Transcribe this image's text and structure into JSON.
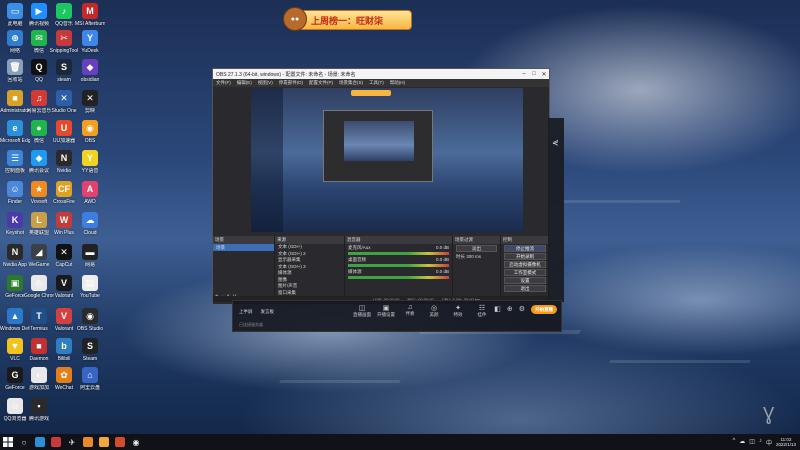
{
  "banner": {
    "text": "上周榜一：旺财柒"
  },
  "desktop_icons": [
    {
      "label": "此电脑",
      "color": "#3a8ee6",
      "glyph": "▭"
    },
    {
      "label": "腾讯视频",
      "color": "#1f8fff",
      "glyph": "▶"
    },
    {
      "label": "QQ音乐",
      "color": "#1ac760",
      "glyph": "♪"
    },
    {
      "label": "MSI Afterburner",
      "color": "#c62828",
      "glyph": "M"
    },
    {
      "label": "网络",
      "color": "#2e7dd1",
      "glyph": "⊕"
    },
    {
      "label": "微信",
      "color": "#20b54a",
      "glyph": "✉"
    },
    {
      "label": "SnippingTool",
      "color": "#c63a3a",
      "glyph": "✂"
    },
    {
      "label": "YuDesk",
      "color": "#3e87e8",
      "glyph": "Y"
    },
    {
      "label": "回收站",
      "color": "#8aa0b8",
      "glyph": "🗑"
    },
    {
      "label": "QQ",
      "color": "#111111",
      "glyph": "Q"
    },
    {
      "label": "steam",
      "color": "#1b2838",
      "glyph": "S"
    },
    {
      "label": "obsidian",
      "color": "#6a3fbf",
      "glyph": "◆"
    },
    {
      "label": "Administrator",
      "color": "#d7a326",
      "glyph": "■"
    },
    {
      "label": "网易云音乐",
      "color": "#d23a36",
      "glyph": "♫"
    },
    {
      "label": "Studio One",
      "color": "#2c5fa6",
      "glyph": "✕"
    },
    {
      "label": "剪映",
      "color": "#222222",
      "glyph": "✕"
    },
    {
      "label": "Microsoft Edge",
      "color": "#2a90d8",
      "glyph": "e"
    },
    {
      "label": "微信",
      "color": "#20b54a",
      "glyph": "●"
    },
    {
      "label": "UU加速器",
      "color": "#e44b2c",
      "glyph": "U"
    },
    {
      "label": "OBS",
      "color": "#f0a020",
      "glyph": "◉"
    },
    {
      "label": "控制面板",
      "color": "#3b84d6",
      "glyph": "☰"
    },
    {
      "label": "腾讯会议",
      "color": "#1e9bf0",
      "glyph": "◆"
    },
    {
      "label": "Nvidia",
      "color": "#2a2a2a",
      "glyph": "N"
    },
    {
      "label": "YY语音",
      "color": "#f2d324",
      "glyph": "Y"
    },
    {
      "label": "Finder",
      "color": "#4c88d9",
      "glyph": "☺"
    },
    {
      "label": "Vovsoft",
      "color": "#f08a1c",
      "glyph": "★"
    },
    {
      "label": "CrossFire",
      "color": "#e0a020",
      "glyph": "CF"
    },
    {
      "label": "AWD",
      "color": "#e4426a",
      "glyph": "A"
    },
    {
      "label": "Keyshot",
      "color": "#4b3ba8",
      "glyph": "K"
    },
    {
      "label": "英雄联盟",
      "color": "#c9a045",
      "glyph": "L"
    },
    {
      "label": "Win Plus",
      "color": "#c43b3b",
      "glyph": "W"
    },
    {
      "label": "Cloud",
      "color": "#3c7fe0",
      "glyph": "☁"
    },
    {
      "label": "Nvidia App",
      "color": "#2a2a2a",
      "glyph": "N"
    },
    {
      "label": "WeGame",
      "color": "#3a3f48",
      "glyph": "◢"
    },
    {
      "label": "CapCut",
      "color": "#111111",
      "glyph": "✕"
    },
    {
      "label": "网易",
      "color": "#222222",
      "glyph": "▬"
    },
    {
      "label": "GeForce",
      "color": "#2b7a2b",
      "glyph": "▣"
    },
    {
      "label": "Google Chrome",
      "color": "#e8e8e8",
      "glyph": "◎"
    },
    {
      "label": "Valorant",
      "color": "#1a1a1a",
      "glyph": "V"
    },
    {
      "label": "YouTube",
      "color": "#ededed",
      "glyph": "▤"
    },
    {
      "label": "Windows Defender",
      "color": "#2c78c8",
      "glyph": "▲"
    },
    {
      "label": "Termius",
      "color": "#1f4f87",
      "glyph": "T"
    },
    {
      "label": "Valorant",
      "color": "#d24040",
      "glyph": "V"
    },
    {
      "label": "OBS Studio",
      "color": "#2a2a2a",
      "glyph": "◉"
    },
    {
      "label": "VLC",
      "color": "#f2c31c",
      "glyph": "▼"
    },
    {
      "label": "Daemon",
      "color": "#c42f2f",
      "glyph": "■"
    },
    {
      "label": "Bilibili",
      "color": "#2f7ec0",
      "glyph": "b"
    },
    {
      "label": "Steam",
      "color": "#222222",
      "glyph": "S"
    },
    {
      "label": "GeForce",
      "color": "#1a1a1a",
      "glyph": "G"
    },
    {
      "label": "游戏加加",
      "color": "#e8e8e8",
      "glyph": "◐"
    },
    {
      "label": "WeChat",
      "color": "#e37e1c",
      "glyph": "✿"
    },
    {
      "label": "阿里云盘",
      "color": "#3865c4",
      "glyph": "⌂"
    },
    {
      "label": "QQ浏览器",
      "color": "#e8e8e8",
      "glyph": "☺"
    },
    {
      "label": "腾讯游戏",
      "color": "#2a2a2a",
      "glyph": "▪"
    }
  ],
  "obs": {
    "title": "OBS 27.1.3 (64-bit, windows) - 配置文件: 未命名 - 场景: 未命名",
    "menu": [
      "文件(F)",
      "编辑(E)",
      "视图(V)",
      "停靠部件(D)",
      "配置文件(P)",
      "场景集合(S)",
      "工具(T)",
      "帮助(H)"
    ],
    "scenes_header": "场景",
    "scenes": [
      "场景"
    ],
    "sources_header": "来源",
    "sources": [
      "文本 (GDI+)",
      "文本 (GDI+) 2",
      "显示器采集",
      "文本 (GDI+) 3",
      "媒体源",
      "图像",
      "图片/声音",
      "窗口采集"
    ],
    "mixer_header": "混音器",
    "mixer": [
      {
        "name": "麦克风/Aux",
        "db": "0.0 dB"
      },
      {
        "name": "桌面音频",
        "db": "0.0 dB"
      },
      {
        "name": "媒体源",
        "db": "0.0 dB"
      }
    ],
    "transitions_header": "场景过渡",
    "transition_value": "淡出",
    "duration_label": "时长",
    "duration_value": "300 ms",
    "controls_header": "控制",
    "controls": [
      "停止推流",
      "开始录制",
      "启动虚拟摄像机",
      "工作室模式",
      "设置",
      "退出"
    ],
    "status": [
      "LIVE: 00:00:00",
      "REC: 00:00:00",
      "CPU: 3.0%, 30.00 fps"
    ]
  },
  "stream_panel": {
    "left_buttons": [
      "上半屏",
      "发言板"
    ],
    "tools": [
      {
        "icon": "◫",
        "label": "直播画面"
      },
      {
        "icon": "▣",
        "label": "开播设置"
      },
      {
        "icon": "♫",
        "label": "伴奏"
      },
      {
        "icon": "◎",
        "label": "美颜"
      },
      {
        "icon": "✦",
        "label": "特效"
      },
      {
        "icon": "☷",
        "label": "挂件"
      }
    ],
    "right_icons": [
      "◧",
      "⊕",
      "⚙"
    ],
    "go_live": "开始直播",
    "footer": "已连接服务器"
  },
  "taskbar": {
    "clock_time": "11:02",
    "clock_date": "2022/1/13",
    "tray_icons": [
      "^",
      "☁",
      "◫",
      "♪",
      "中"
    ]
  }
}
